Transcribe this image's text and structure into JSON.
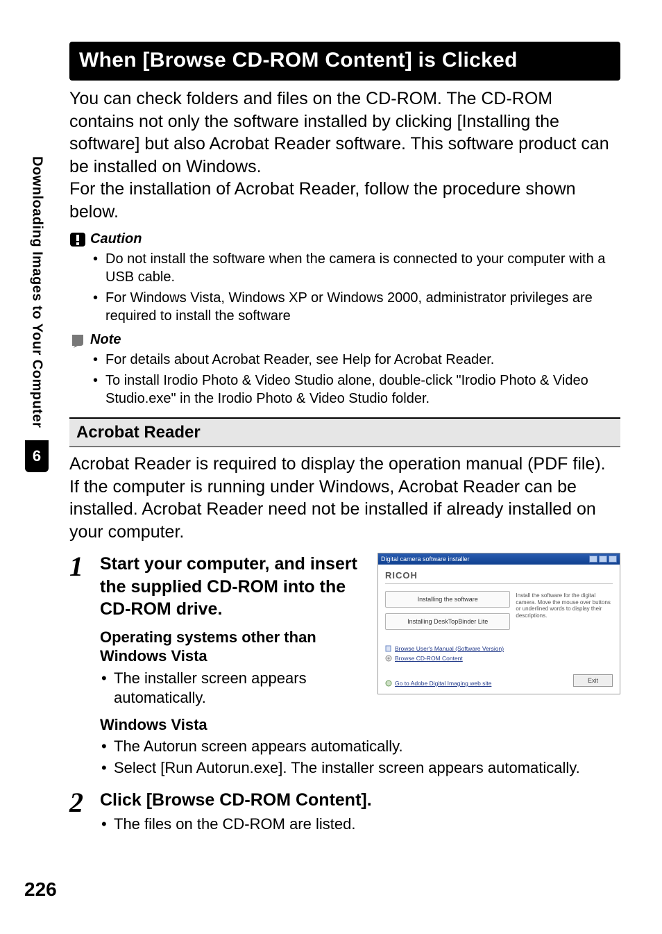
{
  "side": {
    "vertical_label": "Downloading Images to Your Computer",
    "badge": "6"
  },
  "banner": "When [Browse CD-ROM Content] is Clicked",
  "intro_paragraph": "You can check folders and files on the CD-ROM. The CD-ROM contains not only the software installed by clicking [Installing the software] but also Acrobat Reader software. This software product can be installed on Windows.\nFor the installation of Acrobat Reader, follow the procedure shown below.",
  "caution": {
    "title": "Caution",
    "dashes": "----------------------------------------------------------------------------------------------",
    "items": [
      "Do not install the software when the camera is connected to your computer with a USB cable.",
      "For Windows Vista, Windows XP or Windows 2000, administrator privileges are required to install the software"
    ]
  },
  "note": {
    "title": "Note",
    "dashes": "-------------------------------------------------------------------------------------------------",
    "items": [
      "For details about Acrobat Reader, see Help for Acrobat Reader.",
      "To install Irodio Photo & Video Studio alone, double-click \"Irodio Photo & Video Studio.exe\" in the Irodio Photo & Video Studio folder."
    ]
  },
  "acrobat_heading": "Acrobat Reader",
  "acrobat_body": "Acrobat Reader is required to display the operation manual (PDF file).\nIf the computer is running under Windows, Acrobat Reader can be installed. Acrobat Reader need not be installed if already installed on your computer.",
  "steps": [
    {
      "num": "1",
      "title": "Start your computer, and insert the supplied CD-ROM into the CD-ROM drive.",
      "groups": [
        {
          "heading": "Operating systems other than Windows Vista",
          "bullets": [
            "The installer screen appears automatically."
          ]
        },
        {
          "heading": "Windows Vista",
          "bullets": [
            "The Autorun screen appears automatically.",
            "Select [Run Autorun.exe]. The installer screen appears automatically."
          ]
        }
      ]
    },
    {
      "num": "2",
      "title": "Click [Browse CD-ROM Content].",
      "groups": [
        {
          "heading": "",
          "bullets": [
            "The files on the CD-ROM are listed."
          ]
        }
      ]
    }
  ],
  "installer": {
    "titlebar": "Digital camera software installer",
    "brand": "RICOH",
    "btn1": "Installing the software",
    "btn2": "Installing DeskTopBinder Lite",
    "info": "Install the software for the digital camera. Move the mouse over buttons or underlined words to display their descriptions.",
    "link1": "Browse User's Manual (Software Version)",
    "link2": "Browse CD-ROM Content",
    "footer_link": "Go to Adobe Digital Imaging web site",
    "exit": "Exit"
  },
  "page_number": "226"
}
